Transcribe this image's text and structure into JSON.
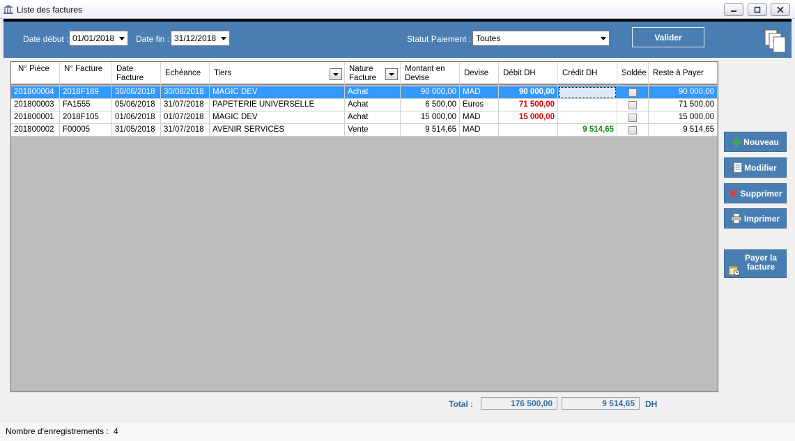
{
  "window": {
    "title": "Liste des factures"
  },
  "filters": {
    "date_debut_label": "Date début :",
    "date_debut_value": "01/01/2018",
    "date_fin_label": "Date fin :",
    "date_fin_value": "31/12/2018",
    "statut_label": "Statut Paiement :",
    "statut_value": "Toutes",
    "valider_label": "Valider"
  },
  "table": {
    "headers": {
      "piece": "N° Pièce",
      "facture": "N° Facture",
      "date": "Date Facture",
      "echeance": "Echéance",
      "tiers": "Tiers",
      "nature": "Nature Facture",
      "montant": "Montant en Devise",
      "devise": "Devise",
      "debit": "Débit DH",
      "credit": "Crédit DH",
      "soldee": "Soldée",
      "reste": "Reste à Payer"
    },
    "rows": [
      {
        "piece": "201800004",
        "facture": "2018F189",
        "date": "30/06/2018",
        "echeance": "30/08/2018",
        "tiers": "MAGIC DEV",
        "nature": "Achat",
        "montant": "90 000,00",
        "devise": "MAD",
        "debit": "90 000,00",
        "credit": "",
        "soldee": false,
        "reste": "90 000,00",
        "selected": true
      },
      {
        "piece": "201800003",
        "facture": "FA1555",
        "date": "05/06/2018",
        "echeance": "31/07/2018",
        "tiers": "PAPETERIE UNIVERSELLE",
        "nature": "Achat",
        "montant": "6 500,00",
        "devise": "Euros",
        "debit": "71 500,00",
        "credit": "",
        "soldee": false,
        "reste": "71 500,00",
        "selected": false
      },
      {
        "piece": "201800001",
        "facture": "2018F105",
        "date": "01/06/2018",
        "echeance": "01/07/2018",
        "tiers": "MAGIC DEV",
        "nature": "Achat",
        "montant": "15 000,00",
        "devise": "MAD",
        "debit": "15 000,00",
        "credit": "",
        "soldee": false,
        "reste": "15 000,00",
        "selected": false
      },
      {
        "piece": "201800002",
        "facture": "F00005",
        "date": "31/05/2018",
        "echeance": "31/07/2018",
        "tiers": "AVENIR SERVICES",
        "nature": "Vente",
        "montant": "9 514,65",
        "devise": "MAD",
        "debit": "",
        "credit": "9 514,65",
        "soldee": false,
        "reste": "9 514,65",
        "selected": false
      }
    ]
  },
  "actions": {
    "nouveau": "Nouveau",
    "modifier": "Modifier",
    "supprimer": "Supprimer",
    "imprimer": "Imprimer",
    "payer": "Payer la facture"
  },
  "totals": {
    "label": "Total :",
    "debit": "176 500,00",
    "credit": "9 514,65",
    "currency": "DH"
  },
  "status": {
    "label": "Nombre d'enregistrements :",
    "count": "4"
  },
  "colors": {
    "accent": "#4a7eb3",
    "selection": "#3399ff",
    "debit_text": "#e00000",
    "credit_text": "#1a8c1a",
    "total_text": "#2f6aa6"
  }
}
